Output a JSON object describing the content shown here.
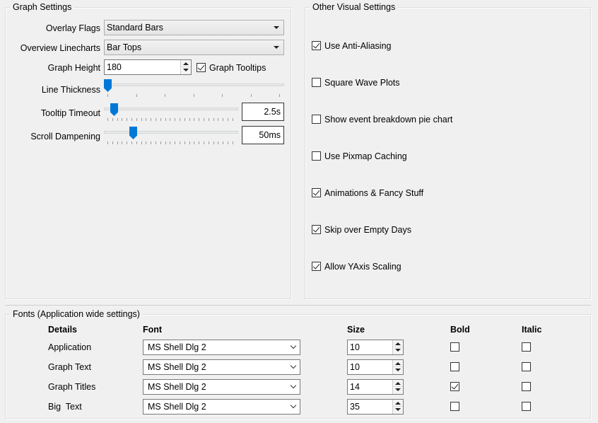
{
  "graph_settings": {
    "title": "Graph Settings",
    "overlay_flags": {
      "label": "Overlay Flags",
      "value": "Standard Bars"
    },
    "overview_linecharts": {
      "label": "Overview Linecharts",
      "value": "Bar Tops"
    },
    "graph_height": {
      "label": "Graph Height",
      "value": "180"
    },
    "graph_tooltips": {
      "label": "Graph Tooltips",
      "checked": true
    },
    "line_thickness": {
      "label": "Line Thickness",
      "position": 0.0
    },
    "tooltip_timeout": {
      "label": "Tooltip Timeout",
      "value": "2.5s",
      "position": 0.06
    },
    "scroll_dampening": {
      "label": "Scroll Dampening",
      "value": "50ms",
      "position": 0.22
    }
  },
  "other_visual": {
    "title": "Other Visual Settings",
    "options": [
      {
        "label": "Use Anti-Aliasing",
        "checked": true
      },
      {
        "label": "Square Wave Plots",
        "checked": false
      },
      {
        "label": "Show event breakdown pie chart",
        "checked": false
      },
      {
        "label": "Use Pixmap Caching",
        "checked": false
      },
      {
        "label": "Animations & Fancy Stuff",
        "checked": true
      },
      {
        "label": "Skip over Empty Days",
        "checked": true
      },
      {
        "label": "Allow YAxis Scaling",
        "checked": true
      }
    ]
  },
  "fonts": {
    "title": "Fonts (Application wide settings)",
    "headers": {
      "details": "Details",
      "font": "Font",
      "size": "Size",
      "bold": "Bold",
      "italic": "Italic"
    },
    "rows": [
      {
        "detail": "Application",
        "font": "MS Shell Dlg 2",
        "size": "10",
        "bold": false,
        "italic": false
      },
      {
        "detail": "Graph Text",
        "font": "MS Shell Dlg 2",
        "size": "10",
        "bold": false,
        "italic": false
      },
      {
        "detail": "Graph Titles",
        "font": "MS Shell Dlg 2",
        "size": "14",
        "bold": true,
        "italic": false
      },
      {
        "detail": "Big  Text",
        "font": "MS Shell Dlg 2",
        "size": "35",
        "bold": false,
        "italic": false
      }
    ]
  }
}
